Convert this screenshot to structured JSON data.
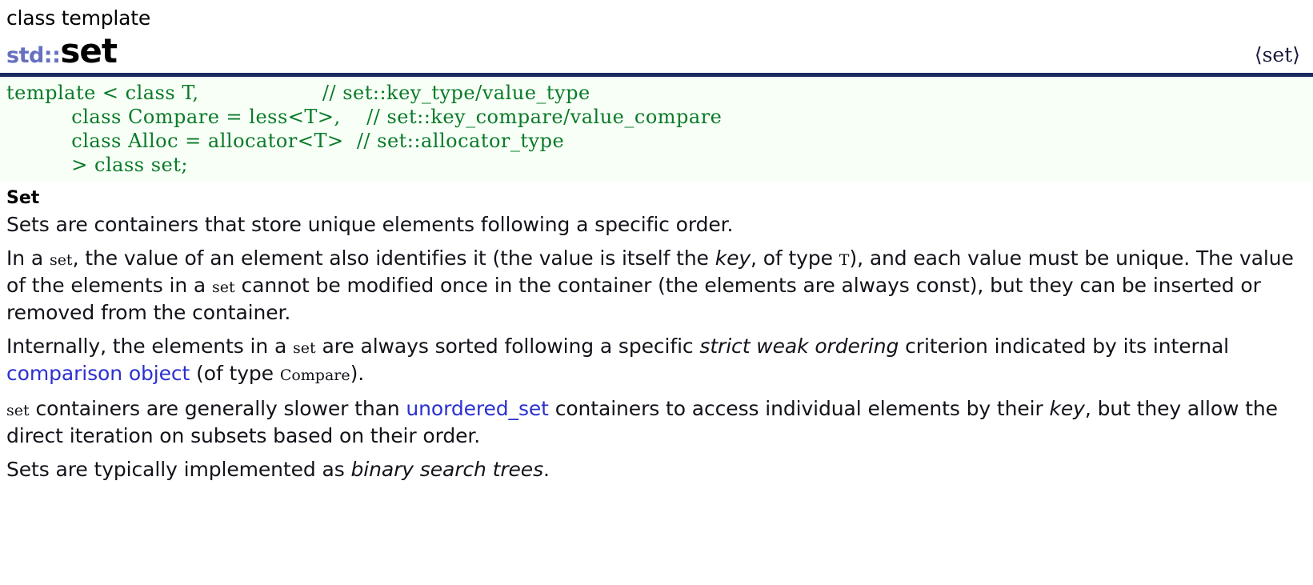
{
  "header": {
    "kicker": "class template",
    "namespace": "std::",
    "name": "set",
    "include": "⟨set⟩"
  },
  "code": {
    "text": "template < class T,                   // set::key_type/value_type\n          class Compare = less<T>,    // set::key_compare/value_compare\n          class Alloc = allocator<T>  // set::allocator_type\n          > class set;"
  },
  "section": {
    "heading": "Set"
  },
  "paragraphs": {
    "p1": "Sets are containers that store unique elements following a specific order.",
    "p2": {
      "t1": "In a ",
      "c1": "set",
      "t2": ", the value of an element also identifies it (the value is itself the ",
      "i1": "key",
      "t3": ", of type ",
      "c2": "T",
      "t4": "), and each value must be unique. The value of the elements in a ",
      "c3": "set",
      "t5": " cannot be modified once in the container (the elements are always const), but they can be inserted or removed from the container."
    },
    "p3": {
      "t1": "Internally, the elements in a ",
      "c1": "set",
      "t2": " are always sorted following a specific ",
      "i1": "strict weak ordering",
      "t3": " criterion indicated by its internal ",
      "link1": "comparison object",
      "t4": " (of type ",
      "c2": "Compare",
      "t5": ")."
    },
    "p4": {
      "c1": "set",
      "t1": " containers are generally slower than ",
      "link1": "unordered_set",
      "t2": " containers to access individual elements by their ",
      "i1": "key",
      "t3": ", but they allow the direct iteration on subsets based on their order."
    },
    "p5": {
      "t1": "Sets are typically implemented as ",
      "i1": "binary search trees",
      "t2": "."
    }
  },
  "colors": {
    "rule": "#1b2a60",
    "code_text": "#0a7a28",
    "code_bg": "#f7fff7",
    "namespace": "#6670c0",
    "link": "#2b31cf"
  }
}
